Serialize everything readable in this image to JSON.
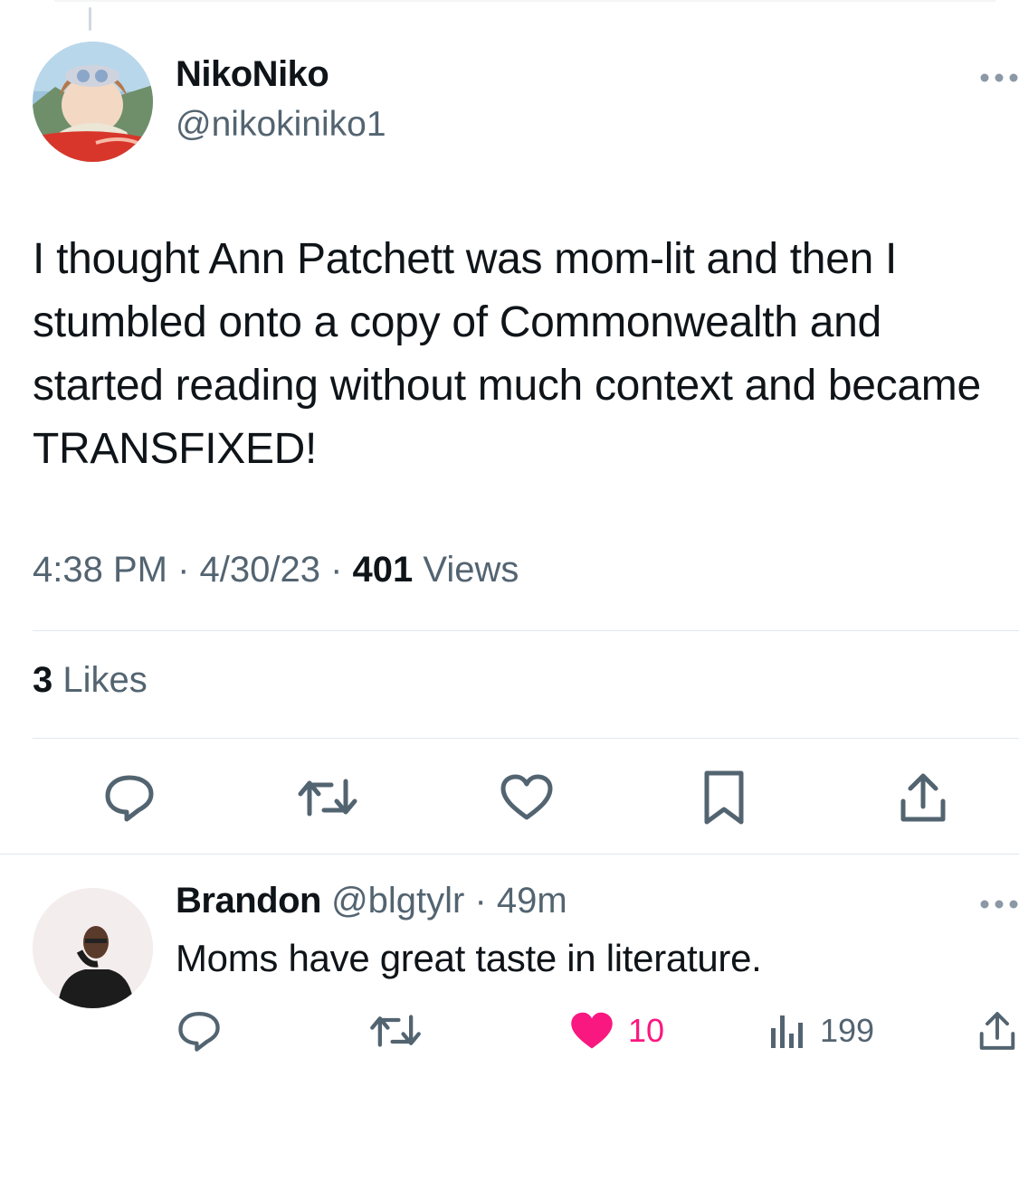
{
  "tweet": {
    "display_name": "NikoNiko",
    "handle": "@nikokiniko1",
    "text": "I thought Ann Patchett was mom-lit and then I stumbled onto a copy of Commonwealth and started reading without much context and became TRANSFIXED!",
    "time": "4:38 PM",
    "date": "4/30/23",
    "views_count": "401",
    "views_label": "Views",
    "likes_count": "3",
    "likes_label": "Likes"
  },
  "reply": {
    "display_name": "Brandon",
    "handle": "@blgtylr",
    "age": "49m",
    "text": "Moms have great taste in literature.",
    "likes_count": "10",
    "views_count": "199"
  },
  "icons": {
    "main_actions": [
      "reply-icon",
      "retweet-icon",
      "like-icon",
      "bookmark-icon",
      "share-icon"
    ],
    "reply_actions": [
      "reply-icon",
      "retweet-icon",
      "liked-heart-icon",
      "views-icon",
      "share-icon"
    ]
  },
  "colors": {
    "text_primary": "#0f1419",
    "text_secondary": "#536471",
    "like_pink": "#f91880",
    "divider": "#e1e8ed"
  }
}
